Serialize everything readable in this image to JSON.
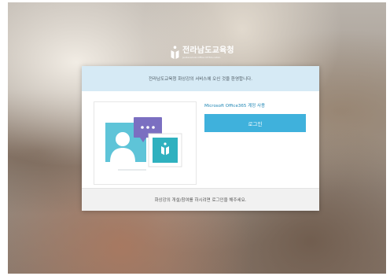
{
  "logo": {
    "icon": "jeonnam-education-logo-icon",
    "title": "전라남도교육청",
    "subtitle": "Jeollanamdo Office Of Education"
  },
  "card": {
    "header_text": "전라남도교육청 화상강의 서비스에 오신 것을 환영합니다.",
    "account_label": "Microsoft Office365 계정 사용",
    "login_button": "로그인",
    "footer_text": "화상강의 개설/참여를 하시려면 로그인을 해주세요."
  },
  "colors": {
    "header_bg": "#d6eaf5",
    "button_bg": "#3fb1dc",
    "account_label": "#1f86b4",
    "footer_bg": "#f1f1f1",
    "illustration_teal": "#2fb1bf",
    "illustration_blue": "#5ec4d8",
    "chat_purple": "#7b6fc1"
  }
}
